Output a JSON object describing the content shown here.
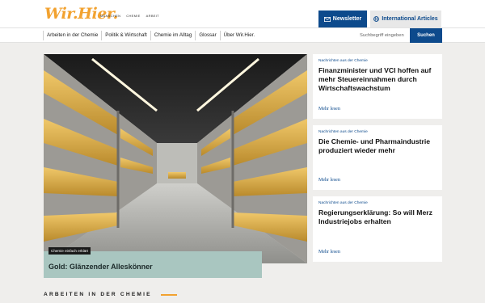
{
  "brand": {
    "logo_text": "Wir.Hier.",
    "tagline": [
      "MENSCHEN",
      "CHEMIE",
      "ARBEIT"
    ]
  },
  "header": {
    "newsletter_label": "Newsletter",
    "international_label": "International Articles"
  },
  "nav": {
    "items": [
      "Arbeiten in der Chemie",
      "Politik & Wirtschaft",
      "Chemie im Alltag",
      "Glossar",
      "Über Wir.Hier."
    ]
  },
  "search": {
    "placeholder": "Suchbegriff eingeben",
    "button_label": "Suchen"
  },
  "hero": {
    "badge": "Chemie einfach erklärt",
    "title": "Gold: Glänzender Alleskönner"
  },
  "cards": [
    {
      "kicker": "Nachrichten aus der Chemie",
      "title": "Finanzminister und VCI hoffen auf mehr Steuereinnahmen durch Wirtschaftswachstum",
      "more": "Mehr lesen"
    },
    {
      "kicker": "Nachrichten aus der Chemie",
      "title": "Die Chemie- und Pharmaindustrie produziert wieder mehr",
      "more": "Mehr lesen"
    },
    {
      "kicker": "Nachrichten aus der Chemie",
      "title": "Regierungserklärung: So will Merz Industriejobs erhalten",
      "more": "Mehr lesen"
    }
  ],
  "section": {
    "heading": "ARBEITEN IN DER CHEMIE"
  },
  "colors": {
    "accent": "#f2a230",
    "primary": "#0d4a8c",
    "caption_bg": "#a9c6c0"
  }
}
